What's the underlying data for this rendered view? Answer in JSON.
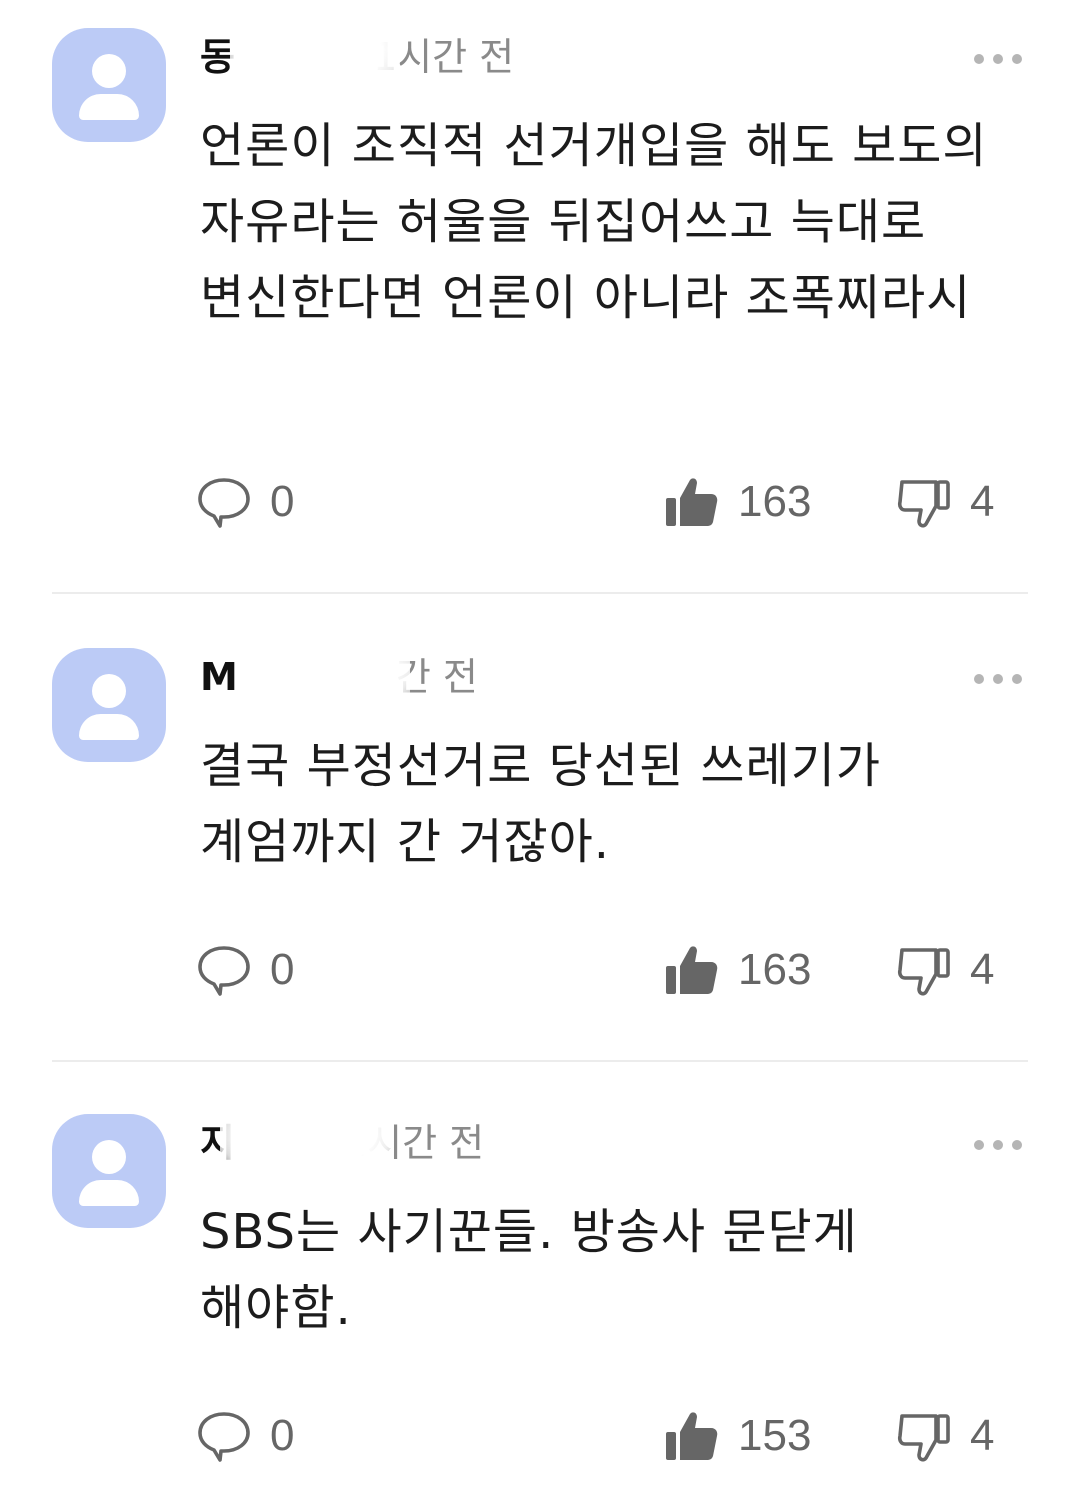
{
  "comments": [
    {
      "author": "동",
      "time": "1시간 전",
      "text": "언론이 조직적 선거개입을 해도 보도의 자유라는 허울을 뒤집어쓰고 늑대로 변신한다면 언론이 아니라 조폭찌라시",
      "replies": "0",
      "likes": "163",
      "dislikes": "4"
    },
    {
      "author": "M",
      "time": "간 전",
      "text": "결국 부정선거로 당선된 쓰레기가 계엄까지 간 거잖아.",
      "replies": "0",
      "likes": "163",
      "dislikes": "4"
    },
    {
      "author": "지",
      "time": "1시간 전",
      "text": "SBS는 사기꾼들. 방송사 문닫게 해야함.",
      "replies": "0",
      "likes": "153",
      "dislikes": "4"
    }
  ],
  "icons": {
    "avatar": "person-icon",
    "more": "more-options-icon",
    "reply": "speech-bubble-icon",
    "like": "thumbs-up-icon",
    "dislike": "thumbs-down-icon"
  },
  "colors": {
    "avatar_bg": "#bccbf6",
    "text": "#1c1c1c",
    "muted": "#8a8a8a",
    "divider": "#ececec"
  }
}
